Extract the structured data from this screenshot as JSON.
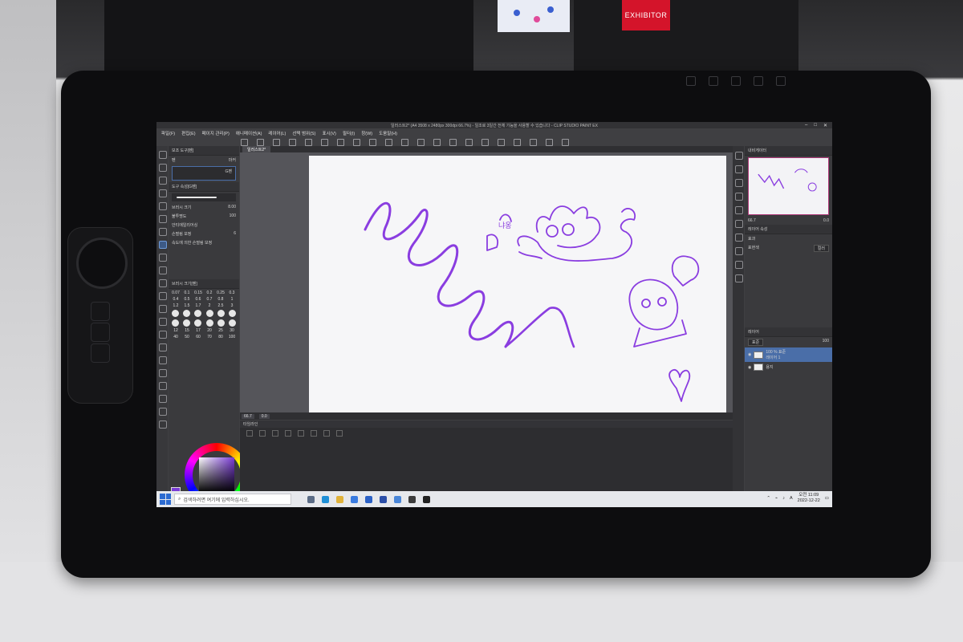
{
  "scene": {
    "exhibitor_sign": "EXHIBITOR"
  },
  "app": {
    "window_title": "일러스트2* (A4 3508 x 2480px 300dpi 66.7%)  - 일조로 3일간 전체 기능을 사용할 수 있습니다 - CLIP STUDIO PAINT EX",
    "menu": [
      "파일(F)",
      "편집(E)",
      "페이지 관리(P)",
      "애니메이션(A)",
      "레이어(L)",
      "선택 범위(S)",
      "표시(V)",
      "필터(I)",
      "창(W)",
      "도움말(H)"
    ],
    "document_tab": "일러스트2*"
  },
  "subtool_panel": {
    "header": "보조 도구[펜]",
    "tabs": [
      "펜",
      "마커"
    ],
    "selected_brush": "G펜",
    "detail_header": "도구 속성[G펜]",
    "rows": [
      {
        "label": "브러시 크기",
        "value": "8.00"
      },
      {
        "label": "불투명도",
        "value": "100"
      },
      {
        "label": "안티에일리어싱",
        "value": ""
      },
      {
        "label": "손떨림 보정",
        "value": "6"
      }
    ],
    "checkbox_label": "속도에 의한 손떨림 보정",
    "sub_header": "브러시 크기[펜]",
    "sizes": [
      "0.07",
      "0.1",
      "0.15",
      "0.2",
      "0.25",
      "0.3",
      "0.4",
      "0.5",
      "0.6",
      "0.7",
      "0.8",
      "1",
      "1.2",
      "1.5",
      "1.7",
      "2",
      "2.5",
      "3",
      "4",
      "5",
      "6",
      "7",
      "8",
      "10",
      "12",
      "15",
      "17",
      "20",
      "25",
      "30",
      "40",
      "50",
      "60",
      "70",
      "80",
      "100"
    ]
  },
  "color": {
    "main": "#7a3cd6",
    "sub": "#ffffff"
  },
  "navigator": {
    "header": "내비게이터",
    "zoom": "66.7",
    "angle": "0.0"
  },
  "layer_property": {
    "header": "레이어 속성",
    "effect_label": "효과",
    "expression_label": "표현색",
    "expression_value": "컬러"
  },
  "layers": {
    "header": "레이어",
    "blend_mode": "표준",
    "opacity": "100",
    "items": [
      {
        "name": "100 % 표준",
        "sub": "레이어 1",
        "selected": true
      },
      {
        "name": "용지",
        "sub": "",
        "selected": false
      }
    ]
  },
  "timeline": {
    "header": "타임라인"
  },
  "taskbar": {
    "search_placeholder": "검색하려면 여기에 입력하십시오.",
    "time": "오전 11:09",
    "date": "2022-12-22",
    "ime": "A"
  },
  "drawing": {
    "stroke_color": "#8a3de0",
    "doodle_text": "냐옹"
  }
}
